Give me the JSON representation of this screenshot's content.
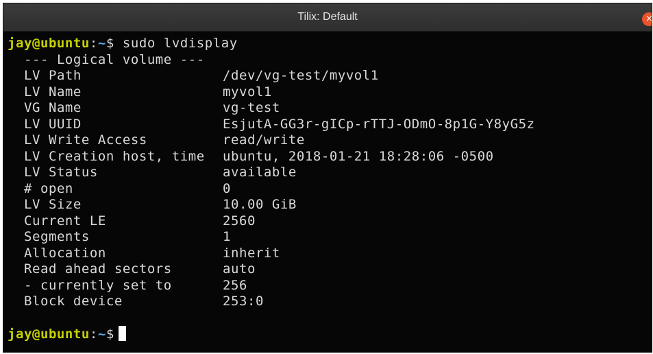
{
  "window": {
    "title": "Tilix: Default",
    "close_glyph": "×"
  },
  "prompt": {
    "user_host": "jay@ubuntu",
    "sep": ":",
    "path": "~",
    "symbol": "$"
  },
  "command": "sudo lvdisplay",
  "header": "--- Logical volume ---",
  "rows": [
    {
      "key": "LV Path",
      "value": "/dev/vg-test/myvol1"
    },
    {
      "key": "LV Name",
      "value": "myvol1"
    },
    {
      "key": "VG Name",
      "value": "vg-test"
    },
    {
      "key": "LV UUID",
      "value": "EsjutA-GG3r-gICp-rTTJ-ODmO-8p1G-Y8yG5z"
    },
    {
      "key": "LV Write Access",
      "value": "read/write"
    },
    {
      "key": "LV Creation host, time",
      "value": "ubuntu, 2018-01-21 18:28:06 -0500"
    },
    {
      "key": "LV Status",
      "value": "available"
    },
    {
      "key": "# open",
      "value": "0"
    },
    {
      "key": "LV Size",
      "value": "10.00 GiB"
    },
    {
      "key": "Current LE",
      "value": "2560"
    },
    {
      "key": "Segments",
      "value": "1"
    },
    {
      "key": "Allocation",
      "value": "inherit"
    },
    {
      "key": "Read ahead sectors",
      "value": "auto"
    },
    {
      "key": "- currently set to",
      "value": "256"
    },
    {
      "key": "Block device",
      "value": "253:0"
    }
  ],
  "colors": {
    "background": "#060606",
    "prompt_user": "#c6d100",
    "prompt_path": "#5aa3e8",
    "close_button": "#e9542c"
  }
}
